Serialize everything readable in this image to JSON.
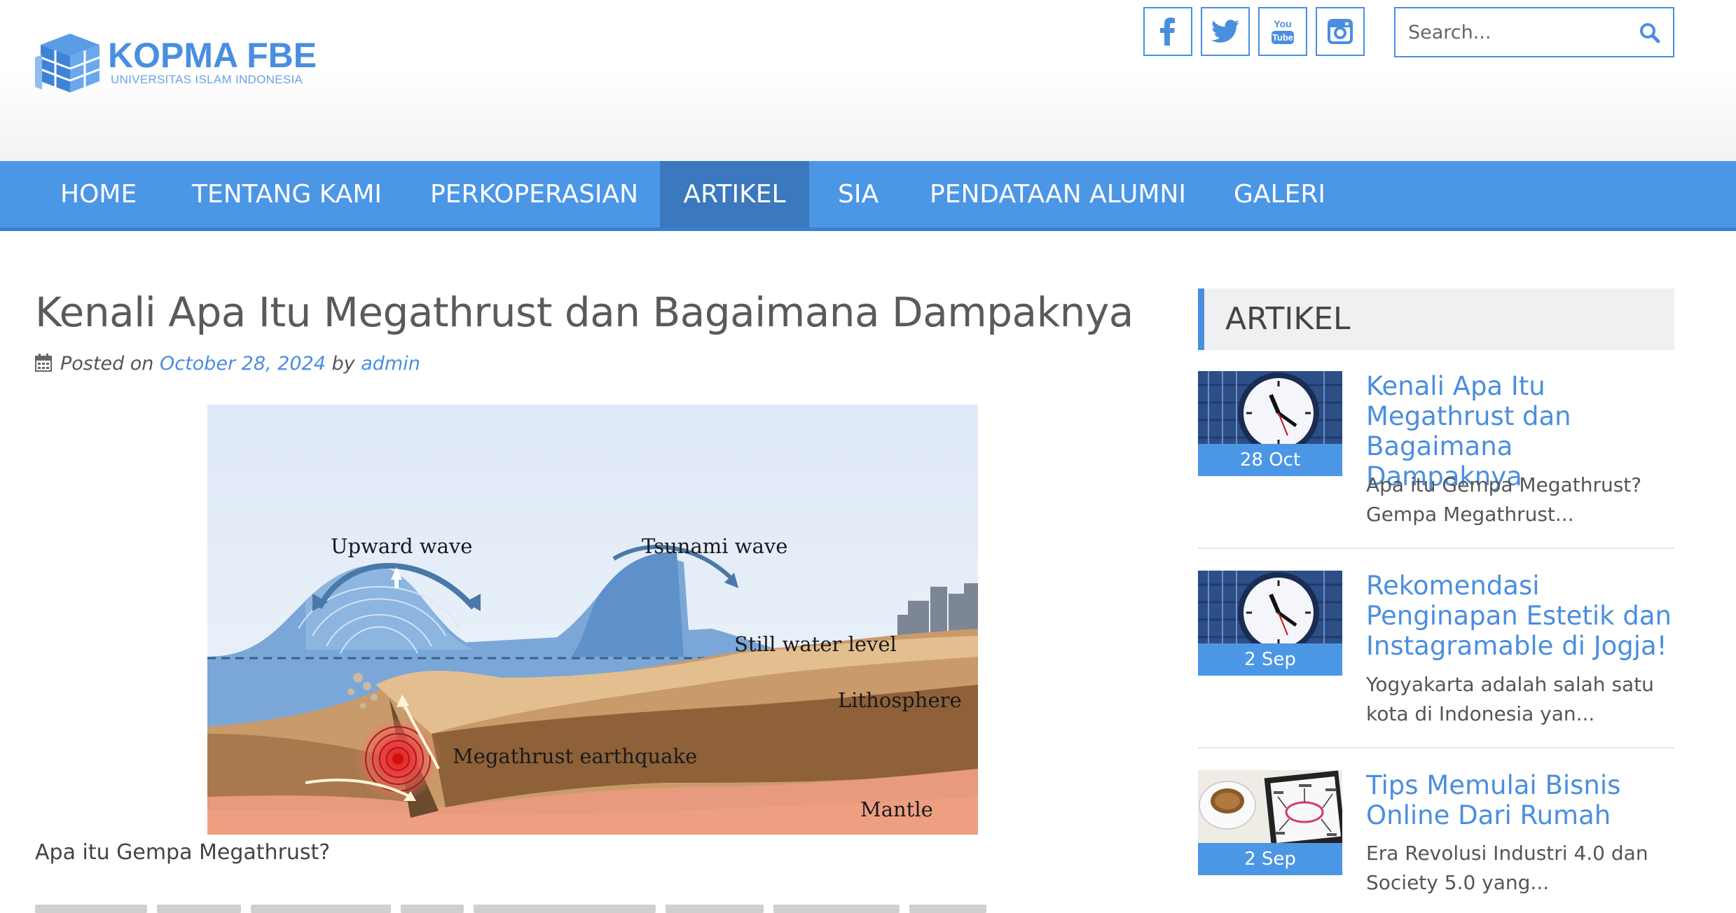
{
  "brand": {
    "title": "KOPMA FBE",
    "subtitle": "UNIVERSITAS ISLAM INDONESIA",
    "accent_color": "#4a8ee0",
    "nav_color": "#4c96e6",
    "nav_active_color": "#3b78bd"
  },
  "social": [
    {
      "name": "facebook",
      "icon": "facebook-icon"
    },
    {
      "name": "twitter",
      "icon": "twitter-icon"
    },
    {
      "name": "youtube",
      "icon": "youtube-icon",
      "top": "You",
      "bottom": "Tube"
    },
    {
      "name": "instagram",
      "icon": "instagram-icon"
    }
  ],
  "search": {
    "placeholder": "Search..."
  },
  "nav": {
    "items": [
      {
        "label": "HOME"
      },
      {
        "label": "TENTANG KAMI"
      },
      {
        "label": "PERKOPERASIAN"
      },
      {
        "label": "ARTIKEL",
        "active": true
      },
      {
        "label": "SIA"
      },
      {
        "label": "PENDATAAN ALUMNI"
      },
      {
        "label": "GALERI"
      }
    ]
  },
  "post": {
    "title": "Kenali Apa Itu Megathrust dan Bagaimana Dampaknya",
    "posted_on": "Posted on",
    "date": "October 28, 2024",
    "by": "by",
    "author": "admin",
    "figure": {
      "labels": {
        "upward_wave": "Upward wave",
        "tsunami_wave": "Tsunami wave",
        "still_water": "Still water level",
        "lithosphere": "Lithosphere",
        "megathrust": "Megathrust earthquake",
        "mantle": "Mantle"
      }
    },
    "caption": "Apa itu Gempa Megathrust?"
  },
  "sidebar": {
    "widget_title": "ARTIKEL",
    "items": [
      {
        "date": "28 Oct",
        "title": "Kenali Apa Itu Megathrust dan Bagaimana Dampaknya",
        "excerpt": "Apa itu Gempa Megathrust? Gempa Megathrust..."
      },
      {
        "date": "2 Sep",
        "title": "Rekomendasi Penginapan Estetik dan Instagramable di Jogja!",
        "excerpt": "Yogyakarta adalah salah satu kota di Indonesia yan..."
      },
      {
        "date": "2 Sep",
        "title": "Tips Memulai Bisnis Online Dari Rumah",
        "excerpt": "Era Revolusi Industri 4.0 dan Society 5.0 yang..."
      }
    ]
  }
}
